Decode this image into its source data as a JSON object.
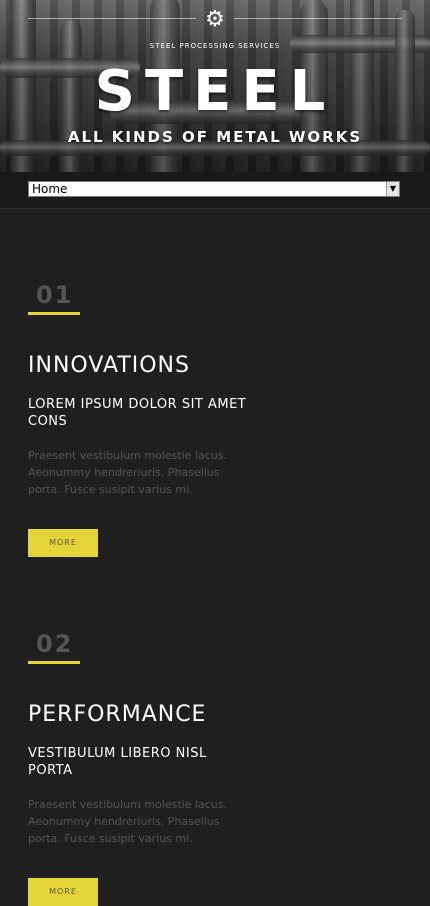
{
  "header": {
    "tagline": "STEEL PROCESSING SERVICES",
    "logo": "STEEL",
    "subtitle": "ALL KINDS OF METAL WORKS"
  },
  "nav": {
    "selected": "Home"
  },
  "sections": [
    {
      "number": "01",
      "title": "INNOVATIONS",
      "subtitle": "LOREM IPSUM DOLOR SIT AMET CONS",
      "body": "Praesent vestibulum molestie lacus. Aeonummy hendreriuris. Phasellus porta. Fusce susipit varius mi.",
      "button": "MORE"
    },
    {
      "number": "02",
      "title": "PERFORMANCE",
      "subtitle": "VESTIBULUM LIBERO NISL PORTA",
      "body": "Praesent vestibulum molestie lacus. Aeonummy hendreriuris. Phasellus porta. Fusce susipit varius mi.",
      "button": "MORE"
    }
  ],
  "colors": {
    "accent": "#e4d43a",
    "background": "#1f1f1f"
  },
  "icons": {
    "header": "gear-icon"
  }
}
